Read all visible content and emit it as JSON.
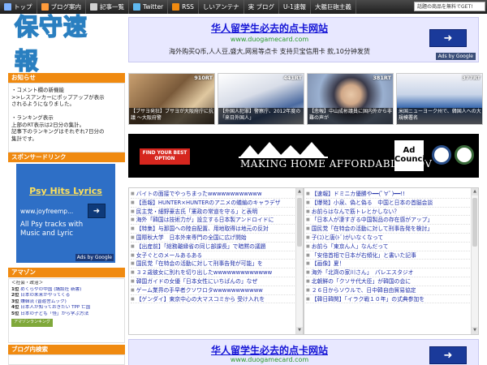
{
  "nav": {
    "items": [
      {
        "label": "トップ",
        "icon": "home-icon",
        "color": "#7fb2ff"
      },
      {
        "label": "ブログ案内",
        "icon": "info-icon",
        "color": "#ff9b3a"
      },
      {
        "label": "記事一覧",
        "icon": "list-icon",
        "color": "#d0d0d0"
      },
      {
        "label": "Twitter",
        "icon": "twitter-icon",
        "color": "#5fb9f0"
      },
      {
        "label": "RSS",
        "icon": "rss-icon",
        "color": "#f08a10"
      },
      {
        "label": "しいアンテナ",
        "icon": "antenna-icon",
        "color": "#888888"
      },
      {
        "label": "実 ブログ",
        "icon": "blog-icon",
        "color": "#888888"
      },
      {
        "label": "U-1速報",
        "icon": "news-icon",
        "color": "#888888"
      },
      {
        "label": "大艦巨砲主義",
        "icon": "ship-icon",
        "color": "#888888"
      }
    ],
    "notice": "話題の商品を無料でGET!"
  },
  "logo": {
    "text": "保守速報"
  },
  "ad_top": {
    "title": "华人留学生必去的点卡网站",
    "url": "www.duogamecard.com",
    "desc": "海外购买Q币,人人豆,盛大,网易等点卡 支持贝宝信用卡 款,10分钟发货",
    "google": "Ads by Google"
  },
  "sidebar": {
    "notice_head": "お知らせ",
    "notice_lines": [
      "・コメント欄の新機能",
      ">>レスアンカーにポップアップが表示",
      "されるようになりました。",
      "",
      "・ランキング表示",
      "上部のRT表示は2日分の集計。",
      "記事下のランキングはそれぞれ7日分の",
      "集計です。"
    ],
    "sponsor_head": "スポンサードリンク",
    "sponsor": {
      "title": "Psy Hits Lyrics",
      "url": "www.joyfreemp...",
      "desc1": "All Psy tracks with",
      "desc2": "Music and Lyric",
      "google": "Ads by Google"
    },
    "amazon_head": "アマゾン",
    "amazon_category": "＜社会・政治＞",
    "amazon_items": [
      {
        "rank": "1位",
        "text": " めくらやの中国 (講談社 新書)"
      },
      {
        "rank": "2位",
        "text": "  日本の未来がやってくる"
      },
      {
        "rank": "3位",
        "text": " 嫌韓流 (晋遊舎ムック)"
      },
      {
        "rank": "4位",
        "text": " 日本人が知っておきたい TPP 亡国"
      },
      {
        "rank": "5位",
        "text": " 日本の子ども「怪」から学ぶ方法"
      }
    ],
    "amazon_button": "アマゾンランキング",
    "blogsearch_head": "ブログ内検索"
  },
  "thumbs": [
    {
      "badge": "910RT",
      "caption": "【ブサヨ発狂】ブサヨが大阪府庁に抗議 ～大阪府警"
    },
    {
      "badge": "441RT",
      "caption": "【外国人犯罪】警察庁、2012年度の「来日外国人」"
    },
    {
      "badge": "381RT",
      "caption": "【悲報】中山成彬議員に国内外から非難の声が"
    },
    {
      "badge": "377RT",
      "caption": "米国ニューヨーク州で、韓国人への大規模署名"
    }
  ],
  "banner": {
    "find": "FIND YOUR BEST OPTION",
    "making": "MAKING HOME AFFORDABLE.GOV",
    "adc": "Ad Council"
  },
  "list_left": [
    "バイトの面接でやっちまったwwwwwwwwwwww",
    "【悲報】HUNTER×HUNTERのアニメの蟻編のキャラデザ",
    "民主党・細野豪志氏「憲政の常道を守る」と表明",
    "海外「韓国は技術力が」設立する日本製アンドロイドに",
    "【特集】与那国への陸自配置、用地取得は地元の反対",
    "国際秋大学　日本外来専門の全国に広げ開始",
    "【出産前】「総務離縁省の同じ部課長」で暗黙の議題",
    "女子ぐとのメールあるある",
    "国民党「在特会の活動に対して刑事告発が可能」を",
    "３２歳彼女に別れを切り出したwwwwwwwwwwwww",
    "韓国ガイドの女優「日本女性にいちばんの」なぜ",
    "ゲーム業界の手早者クソワロタwwwwwwwwwww",
    "【ゲンダイ】東京中心の大マスコミから 受け入れを"
  ],
  "list_right": [
    "【速報】ドミニカ優勝や━━(ﾟ∀ﾟ)━━!!",
    "【爆発】小泉、偽と偽る　中国と日本の首脳会談",
    "お前らはなんで筋トレとかしない？",
    "「日本人が凄すぎる中国製品の存在感がアップ」",
    "国民党「在特会の活動に対して刑事告発を検討」",
    "子(ｺ)と唐(ﾄﾞ)がいなくなって",
    "お前ら「東京ん人」なんだって",
    "「安倍首相で日本が右傾化」と書いた記事",
    "【画像】夏！",
    "海外「北齊の家川さん」　パレエスタジオ",
    "北朝鮮の「クソサ代大臣」が韓国の会に",
    "２６日からソウルで、日中韓自由貿易協定",
    "【韓日韓関】「イラク戦１０年」の式典参加を"
  ],
  "ad_bottom": {
    "title": "华人留学生必去的点卡网站",
    "url": "www.duogamecard.com"
  }
}
